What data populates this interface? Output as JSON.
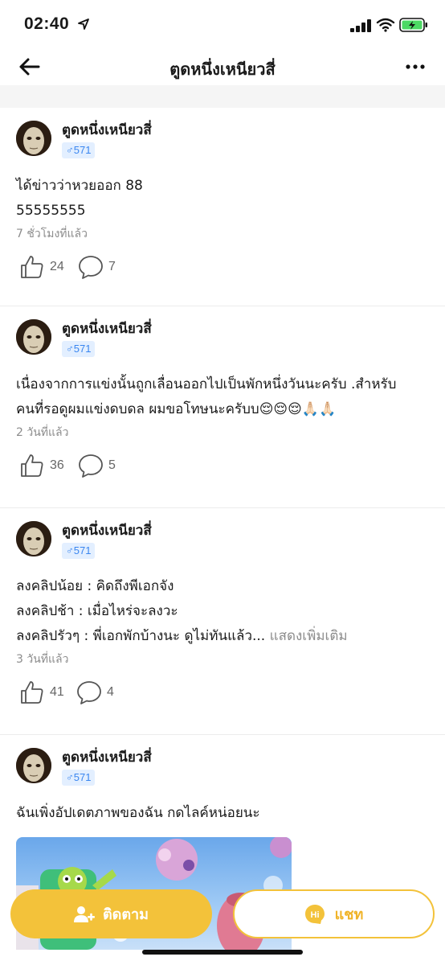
{
  "status_bar": {
    "time": "02:40"
  },
  "nav": {
    "title": "ตูดหนึ่งเหนียวสี่"
  },
  "posts": [
    {
      "author": "ตูดหนึ่งเหนียวสี่",
      "badge": "♂571",
      "lines": [
        "ได้ข่าวว่าหวยออก 88",
        "55555555"
      ],
      "time": "7 ชั่วโมงที่แล้ว",
      "likes": "24",
      "comments": "7"
    },
    {
      "author": "ตูดหนึ่งเหนียวสี่",
      "badge": "♂571",
      "lines": [
        "เนื่องจากการแข่งนั้นถูกเลื่อนออกไปเป็นพักหนึ่งวันนะครับ .สำหรับ",
        "คนที่รอดูผมแข่งดบดล ผมขอโทษนะครับบ😌😌😌🙏🏻🙏🏻"
      ],
      "time": "2 วันที่แล้ว",
      "likes": "36",
      "comments": "5"
    },
    {
      "author": "ตูดหนึ่งเหนียวสี่",
      "badge": "♂571",
      "lines": [
        "ลงคลิปน้อย : คิดถึงพีเอกจัง",
        "ลงคลิปช้า : เมื่อไหร่จะลงวะ",
        "ลงคลิปรัวๆ : พี่เอกพักบ้างนะ ดูไม่ทันแล้ว..."
      ],
      "see_more": " แสดงเพิ่มเติม",
      "time": "3 วันที่แล้ว",
      "likes": "41",
      "comments": "4"
    },
    {
      "author": "ตูดหนึ่งเหนียวสี่",
      "badge": "♂571",
      "lines": [
        "ฉันเพิ่งอัปเดตภาพของฉัน กดไลค์หน่อยนะ"
      ]
    }
  ],
  "bottom": {
    "follow_label": "ติดตาม",
    "chat_label": "แชท",
    "chat_icon_text": "Hi"
  },
  "colors": {
    "accent": "#f3c23a",
    "badge_bg": "#e3efff",
    "badge_text": "#3a86f0",
    "muted": "#8c8c8c"
  },
  "icons": [
    "back-arrow-icon",
    "more-dots-icon",
    "thumbs-up-icon",
    "comment-bubble-icon",
    "add-user-icon",
    "chat-hi-icon",
    "location-arrow-icon",
    "signal-icon",
    "wifi-icon",
    "battery-icon"
  ]
}
